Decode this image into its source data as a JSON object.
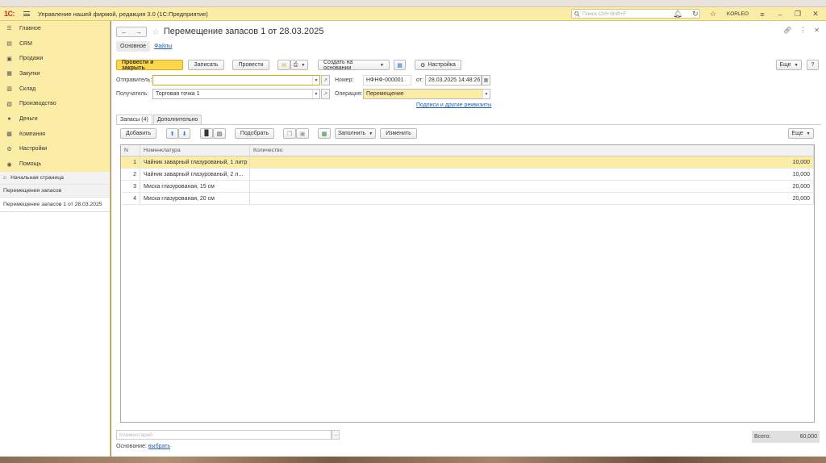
{
  "app": {
    "logo": "1С:",
    "title": "Управление нашей фирмой, редакция 3.0  (1С:Предприятие)",
    "search_placeholder": "Поиск Ctrl+Shift+F",
    "user": "KORLEO"
  },
  "sidebar": {
    "items": [
      {
        "label": "Главное",
        "icon": "menu-icon"
      },
      {
        "label": "CRM",
        "icon": "crm-icon"
      },
      {
        "label": "Продажи",
        "icon": "sales-icon"
      },
      {
        "label": "Закупки",
        "icon": "purchases-icon"
      },
      {
        "label": "Склад",
        "icon": "warehouse-icon"
      },
      {
        "label": "Производство",
        "icon": "production-icon"
      },
      {
        "label": "Деньги",
        "icon": "money-icon"
      },
      {
        "label": "Компания",
        "icon": "company-icon"
      },
      {
        "label": "Настройки",
        "icon": "settings-icon"
      },
      {
        "label": "Помощь",
        "icon": "help-icon"
      }
    ],
    "history": {
      "home": "Начальная страница",
      "item1": "Перемещения запасов",
      "active": "Перемещение запасов 1 от 28.03.2025"
    }
  },
  "document": {
    "title": "Перемещение запасов 1 от 28.03.2025",
    "subtabs": {
      "main": "Основное",
      "files": "Файлы"
    },
    "toolbar": {
      "post_close": "Провести и закрыть",
      "save": "Записать",
      "post": "Провести",
      "create_based": "Создать на основании",
      "settings": "Настройка",
      "more": "Еще",
      "help": "?"
    },
    "fields": {
      "sender_label": "Отправитель:",
      "sender_value": "",
      "receiver_label": "Получатель:",
      "receiver_value": "Торговая точка 1",
      "number_label": "Номер:",
      "number_value": "НФНФ-000001",
      "date_label": "от:",
      "date_value": "28.03.2025 14:48:26",
      "operation_label": "Операция:",
      "operation_value": "Перемещение",
      "signatures_link": "Подписи и другие реквизиты"
    },
    "tabs": {
      "stocks": "Запасы (4)",
      "additional": "Дополнительно"
    },
    "table_toolbar": {
      "add": "Добавить",
      "pick": "Подобрать",
      "fill": "Заполнить",
      "change": "Изменить",
      "more": "Еще"
    },
    "table": {
      "columns": [
        "N",
        "Номенклатура",
        "Количество"
      ],
      "rows": [
        {
          "n": "1",
          "nom": "Чайник заварный глазурованый, 1 литр",
          "qty": "10,000"
        },
        {
          "n": "2",
          "nom": "Чайник заварный глазурованый, 2 л...",
          "qty": "10,000"
        },
        {
          "n": "3",
          "nom": "Миска глазурованая, 15 см",
          "qty": "20,000"
        },
        {
          "n": "4",
          "nom": "Миска глазурованая, 20 см",
          "qty": "20,000"
        }
      ]
    },
    "footer": {
      "comment_placeholder": "Комментарий",
      "basis_label": "Основание:",
      "basis_link": "выбрать",
      "total_label": "Всего:",
      "total_value": "60,000"
    }
  },
  "colors": {
    "accent_yellow": "#fbeda6",
    "button_primary": "#fcd84a",
    "link": "#1f5fb0"
  }
}
